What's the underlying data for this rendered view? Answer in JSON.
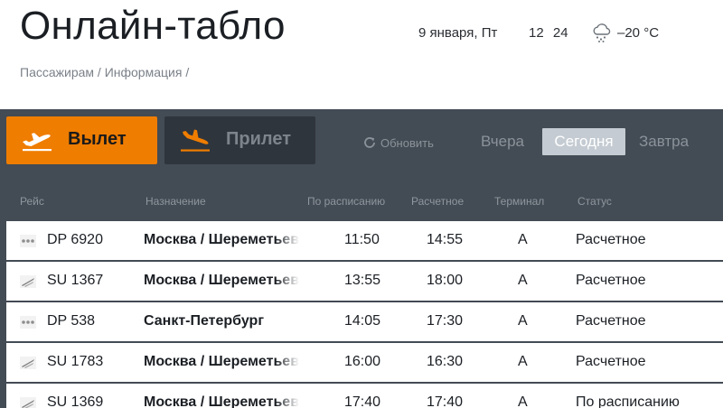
{
  "header": {
    "title": "Онлайн-табло",
    "date": "9 января, Пт",
    "time": "12 24",
    "temperature": "–20 °C",
    "weather_icon": "snow-cloud-icon",
    "breadcrumb": [
      "Пассажирам",
      "Информация"
    ],
    "breadcrumb_sep": "/"
  },
  "toolbar": {
    "departures_label": "Вылет",
    "arrivals_label": "Прилет",
    "refresh_label": "Обновить",
    "days": {
      "yesterday": "Вчера",
      "today": "Сегодня",
      "tomorrow": "Завтра"
    },
    "active_day": "today",
    "active_direction": "departures"
  },
  "table": {
    "columns": [
      "Рейс",
      "Назначение",
      "По расписанию",
      "Расчетное",
      "Терминал",
      "Статус"
    ],
    "rows": [
      {
        "logo": "dp",
        "flight": "DP 6920",
        "destination": "Москва / Шереметьево",
        "scheduled": "11:50",
        "estimated": "14:55",
        "terminal": "A",
        "status": "Расчетное"
      },
      {
        "logo": "su",
        "flight": "SU 1367",
        "destination": "Москва / Шереметьево",
        "scheduled": "13:55",
        "estimated": "18:00",
        "terminal": "A",
        "status": "Расчетное"
      },
      {
        "logo": "dp",
        "flight": "DP 538",
        "destination": "Санкт-Петербург",
        "scheduled": "14:05",
        "estimated": "17:30",
        "terminal": "A",
        "status": "Расчетное"
      },
      {
        "logo": "su",
        "flight": "SU 1783",
        "destination": "Москва / Шереметьево",
        "scheduled": "16:00",
        "estimated": "16:30",
        "terminal": "A",
        "status": "Расчетное"
      },
      {
        "logo": "su",
        "flight": "SU 1369",
        "destination": "Москва / Шереметьево",
        "scheduled": "17:40",
        "estimated": "17:40",
        "terminal": "A",
        "status": "По расписанию"
      }
    ]
  },
  "colors": {
    "accent": "#ef7d00",
    "board_bg": "#434b54",
    "active_tab": "#c4cbd2"
  }
}
